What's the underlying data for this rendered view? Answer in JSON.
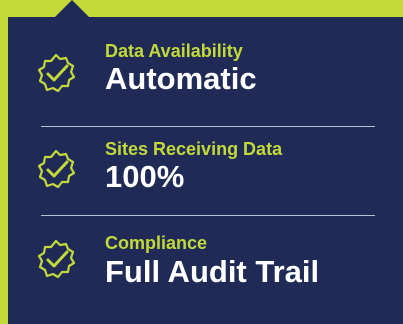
{
  "colors": {
    "accent": "#c3d93a",
    "panel": "#1f2a57",
    "text": "#ffffff",
    "divider": "#c9d1e6"
  },
  "items": [
    {
      "icon": "check-badge-icon",
      "label": "Data Availability",
      "value": "Automatic"
    },
    {
      "icon": "check-badge-icon",
      "label": "Sites Receiving Data",
      "value": "100%"
    },
    {
      "icon": "check-badge-icon",
      "label": "Compliance",
      "value": "Full Audit Trail"
    }
  ]
}
